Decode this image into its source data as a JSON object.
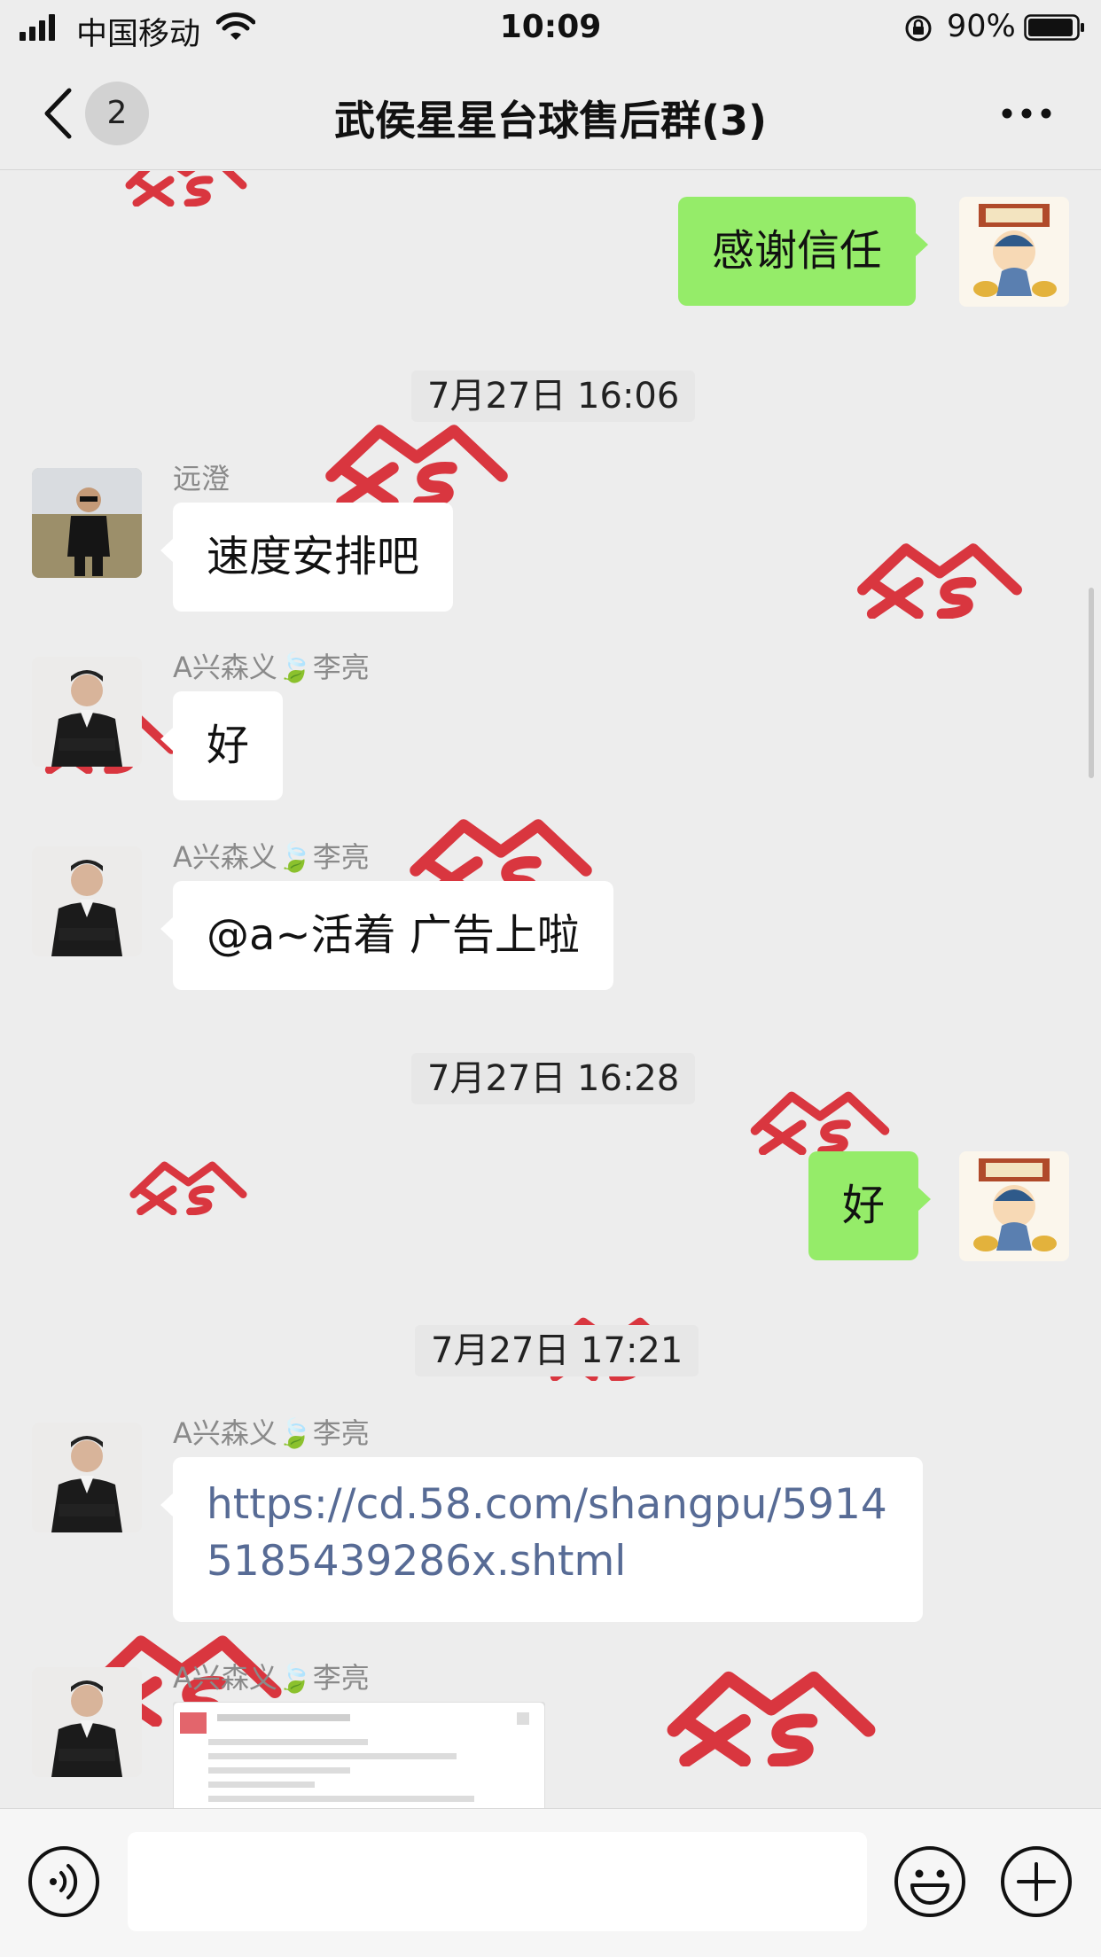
{
  "status_bar": {
    "carrier": "中国移动",
    "time": "10:09",
    "battery": "90%"
  },
  "nav": {
    "badge": "2",
    "title": "武侯星星台球售后群(3)"
  },
  "watermark": {
    "text": "XSY",
    "color": "#d7232d"
  },
  "colors": {
    "self_bubble": "#95ec69",
    "link": "#576b95",
    "background": "#ededed"
  },
  "messages": {
    "m1": {
      "text": "感谢信任"
    },
    "t1": {
      "text": "7月27日 16:06"
    },
    "m2": {
      "sender": "远澄",
      "text": "速度安排吧"
    },
    "m3": {
      "sender": "A兴森义🍃李亮",
      "text": "好"
    },
    "m4": {
      "sender": "A兴森义🍃李亮",
      "text": "@a~活着 广告上啦"
    },
    "t2": {
      "text": "7月27日 16:28"
    },
    "m5": {
      "text": "好"
    },
    "t3": {
      "text": "7月27日 17:21"
    },
    "m6": {
      "sender": "A兴森义🍃李亮",
      "text": "https://cd.58.com/shangpu/59145185439286x.shtml"
    },
    "m7": {
      "sender": "A兴森义🍃李亮"
    }
  }
}
